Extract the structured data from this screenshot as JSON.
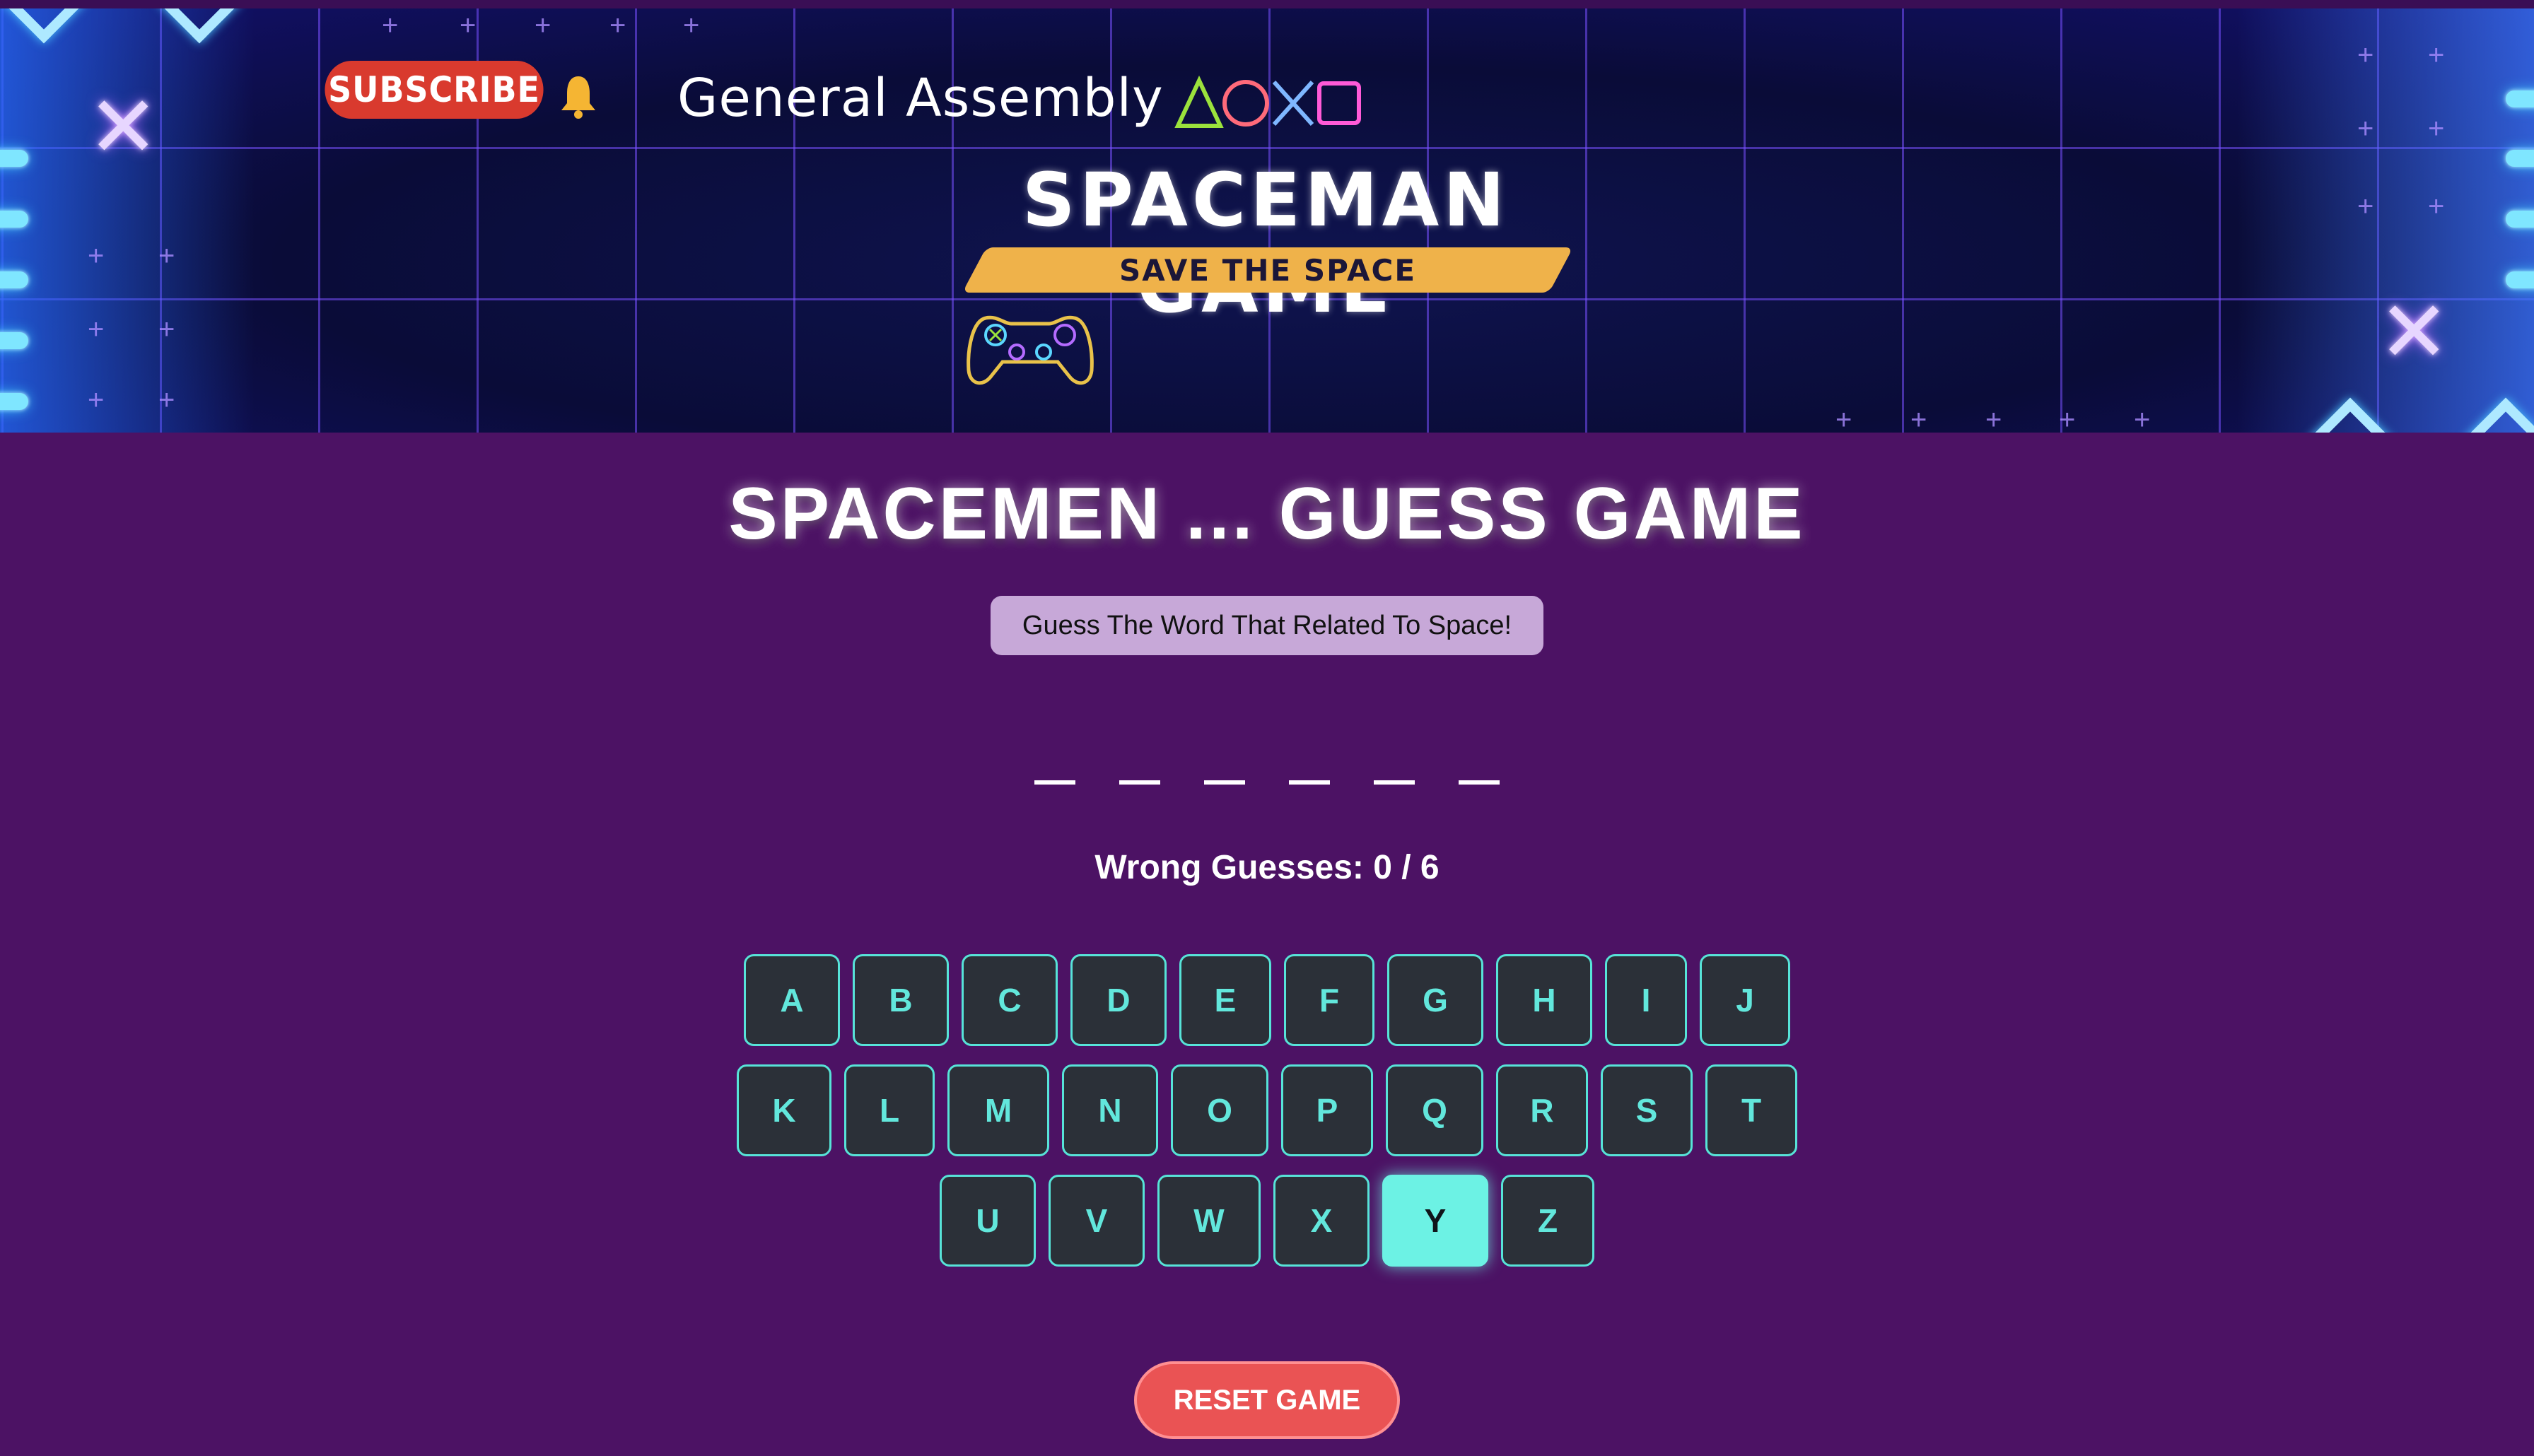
{
  "banner": {
    "subscribe_label": "SUBSCRIBE",
    "brand": "General Assembly",
    "title": "SPACEMAN GAME",
    "tagline": "SAVE THE SPACE",
    "icons": [
      "bell-icon",
      "triangle-icon",
      "circle-icon",
      "cross-icon",
      "square-icon",
      "game-controller-icon"
    ]
  },
  "game": {
    "title": "SPACEMEN ... GUESS GAME",
    "hint": "Guess The Word That Related To Space!",
    "word_slots": [
      "",
      "",
      "",
      "",
      "",
      ""
    ],
    "wrong_guesses_label": "Wrong Guesses: 0 / 6",
    "keyboard": {
      "row1": [
        "A",
        "B",
        "C",
        "D",
        "E",
        "F",
        "G",
        "H",
        "I",
        "J"
      ],
      "row2": [
        "K",
        "L",
        "M",
        "N",
        "O",
        "P",
        "Q",
        "R",
        "S",
        "T"
      ],
      "row3": [
        "U",
        "V",
        "W",
        "X",
        "Y",
        "Z"
      ],
      "highlighted": "Y"
    },
    "reset_label": "RESET GAME"
  },
  "colors": {
    "page_bg": "#4c1264",
    "key_bg": "#2b3038",
    "key_accent": "#57e3d8",
    "key_active": "#6cf2e4",
    "reset_bg": "#ea5354",
    "hint_bg": "#c7a8d8",
    "tagline_band": "#efb24a"
  }
}
